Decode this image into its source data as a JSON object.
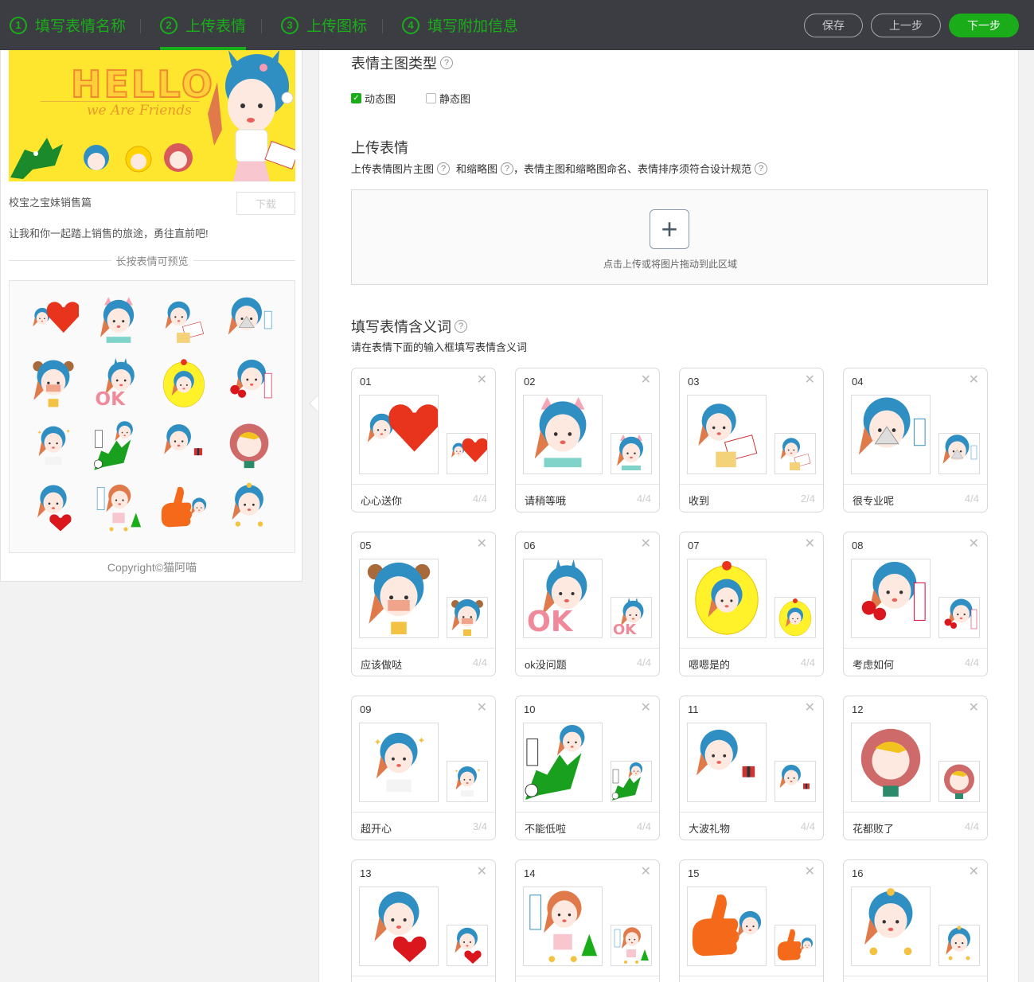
{
  "steps": [
    {
      "num": "1",
      "label": "填写表情名称"
    },
    {
      "num": "2",
      "label": "上传表情"
    },
    {
      "num": "3",
      "label": "上传图标"
    },
    {
      "num": "4",
      "label": "填写附加信息"
    }
  ],
  "toolbar": {
    "save": "保存",
    "prev": "上一步",
    "next": "下一步"
  },
  "preview": {
    "banner_title": "HELLO",
    "banner_sub": "we Are Friends",
    "package_name": "校宝之宝妹销售篇",
    "download": "下载",
    "description": "让我和你一起踏上销售的旅途，勇往直前吧!",
    "long_press_hint": "长按表情可预览",
    "copyright": "Copyright©猫阿喵"
  },
  "main": {
    "type_title": "表情主图类型",
    "type_options": [
      {
        "label": "动态图",
        "checked": true
      },
      {
        "label": "静态图",
        "checked": false
      }
    ],
    "upload_title": "上传表情",
    "upload_desc_1": "上传表情图片主图",
    "upload_desc_2": "和缩略图",
    "upload_desc_3": "，表情主图和缩略图命名、表情排序须符合设计规范",
    "upload_tip": "点击上传或将图片拖动到此区域",
    "meaning_title": "填写表情含义词",
    "meaning_desc": "请在表情下面的输入框填写表情含义词"
  },
  "stickers": [
    {
      "no": "01",
      "meaning": "心心送你",
      "count": "4/4",
      "prop": "heart"
    },
    {
      "no": "02",
      "meaning": "请稍等哦",
      "count": "4/4",
      "prop": "cat"
    },
    {
      "no": "03",
      "meaning": "收到",
      "count": "2/4",
      "prop": "letter"
    },
    {
      "no": "04",
      "meaning": "很专业呢",
      "count": "4/4",
      "prop": "fan"
    },
    {
      "no": "05",
      "meaning": "应该做哒",
      "count": "4/4",
      "prop": "bear"
    },
    {
      "no": "06",
      "meaning": "ok没问题",
      "count": "4/4",
      "prop": "ok"
    },
    {
      "no": "07",
      "meaning": "嗯嗯是的",
      "count": "4/4",
      "prop": "chick"
    },
    {
      "no": "08",
      "meaning": "考虑如何",
      "count": "4/4",
      "prop": "rose"
    },
    {
      "no": "09",
      "meaning": "超开心",
      "count": "3/4",
      "prop": "happy"
    },
    {
      "no": "10",
      "meaning": "不能低啦",
      "count": "4/4",
      "prop": "croc"
    },
    {
      "no": "11",
      "meaning": "大波礼物",
      "count": "4/4",
      "prop": "gift"
    },
    {
      "no": "12",
      "meaning": "花都败了",
      "count": "4/4",
      "prop": "flower"
    },
    {
      "no": "13",
      "meaning": "",
      "count": "",
      "prop": "heart2"
    },
    {
      "no": "14",
      "meaning": "",
      "count": "",
      "prop": "scooter"
    },
    {
      "no": "15",
      "meaning": "",
      "count": "",
      "prop": "thumb"
    },
    {
      "no": "16",
      "meaning": "",
      "count": "",
      "prop": "money"
    }
  ],
  "colors": {
    "accent": "#1aad19",
    "topbar": "#3b3d42",
    "hair": "#2f8fc2",
    "hair_orange": "#e07a4a"
  }
}
